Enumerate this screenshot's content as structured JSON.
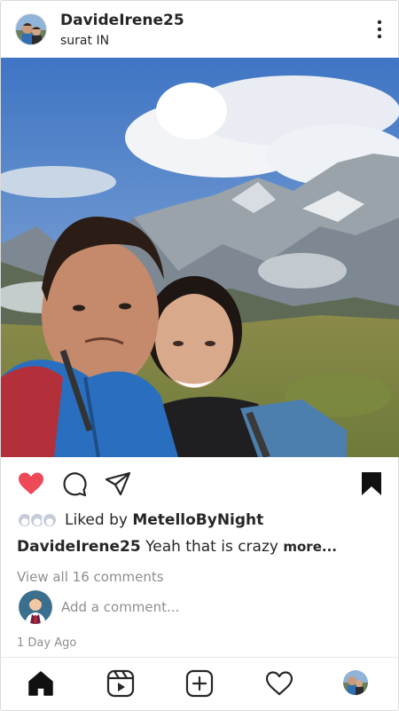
{
  "post": {
    "username": "DavideIrene25",
    "location": "surat IN",
    "avatar_icon": "couple-avatar"
  },
  "actions": {
    "like_icon": "heart-filled-icon",
    "comment_icon": "comment-icon",
    "share_icon": "paper-plane-icon",
    "save_icon": "bookmark-filled-icon",
    "like_color": "#ed4956"
  },
  "likes": {
    "prefix": "Liked by ",
    "user": "MetelloByNight"
  },
  "caption": {
    "username": "DavideIrene25",
    "text": " Yeah that is crazy ",
    "more_label": "more..."
  },
  "comments": {
    "view_all_label": "View all 16 comments",
    "input_placeholder": "Add a comment..."
  },
  "timestamp": "1 Day Ago",
  "nav": {
    "items": [
      "home-icon",
      "reels-icon",
      "new-post-icon",
      "activity-heart-icon",
      "profile-avatar"
    ]
  }
}
